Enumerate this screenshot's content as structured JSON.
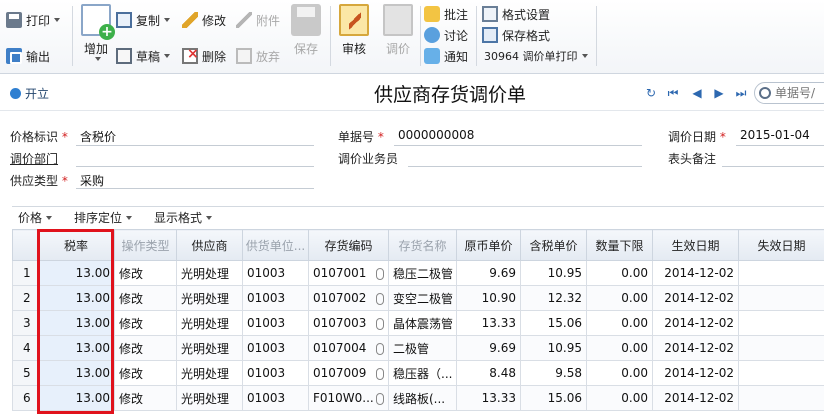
{
  "toolbar": {
    "print": "打印",
    "export": "输出",
    "add": "增加",
    "copy": "复制",
    "draft": "草稿",
    "edit": "修改",
    "delete": "删除",
    "attach": "附件",
    "abandon": "放弃",
    "save": "保存",
    "audit": "审核",
    "adjust": "调价",
    "comment": "批注",
    "discuss": "讨论",
    "notify": "通知",
    "format_settings": "格式设置",
    "save_format": "保存格式",
    "template_id": "30964",
    "template_name": "调价单打印"
  },
  "titlebar": {
    "open": "开立",
    "title": "供应商存货调价单",
    "search_placeholder": "单据号/"
  },
  "form": {
    "price_flag_label": "价格标识",
    "price_flag_value": "含税价",
    "doc_no_label": "单据号",
    "doc_no_value": "0000000008",
    "adjust_date_label": "调价日期",
    "adjust_date_value": "2015-01-04",
    "dept_label": "调价部门",
    "clerk_label": "调价业务员",
    "header_note_label": "表头备注",
    "supply_type_label": "供应类型",
    "supply_type_value": "采购"
  },
  "grid_bar": {
    "price": "价格",
    "sort": "排序定位",
    "display": "显示格式"
  },
  "grid": {
    "columns": [
      "",
      "税率",
      "操作类型",
      "供应商",
      "供货单位...",
      "存货编码",
      "存货名称",
      "原币单价",
      "含税单价",
      "数量下限",
      "生效日期",
      "失效日期"
    ],
    "rows": [
      [
        "1",
        "13.00",
        "修改",
        "光明处理",
        "01003",
        "0107001",
        "稳压二极管",
        "9.69",
        "10.95",
        "0.00",
        "2014-12-02",
        ""
      ],
      [
        "2",
        "13.00",
        "修改",
        "光明处理",
        "01003",
        "0107002",
        "变空二极管",
        "10.90",
        "12.32",
        "0.00",
        "2014-12-02",
        ""
      ],
      [
        "3",
        "13.00",
        "修改",
        "光明处理",
        "01003",
        "0107003",
        "晶体震荡管",
        "13.33",
        "15.06",
        "0.00",
        "2014-12-02",
        ""
      ],
      [
        "4",
        "13.00",
        "修改",
        "光明处理",
        "01003",
        "0107004",
        "二极管",
        "9.69",
        "10.95",
        "0.00",
        "2014-12-02",
        ""
      ],
      [
        "5",
        "13.00",
        "修改",
        "光明处理",
        "01003",
        "0107009",
        "稳压器（...",
        "8.48",
        "9.58",
        "0.00",
        "2014-12-02",
        ""
      ],
      [
        "6",
        "13.00",
        "修改",
        "光明处理",
        "01003",
        "F010W0...",
        "线路板(...",
        "13.33",
        "15.06",
        "0.00",
        "2014-12-02",
        ""
      ]
    ]
  },
  "colors": {
    "highlight": "#e0121c",
    "accent": "#2f7fd1",
    "required": "#d21f1f"
  }
}
